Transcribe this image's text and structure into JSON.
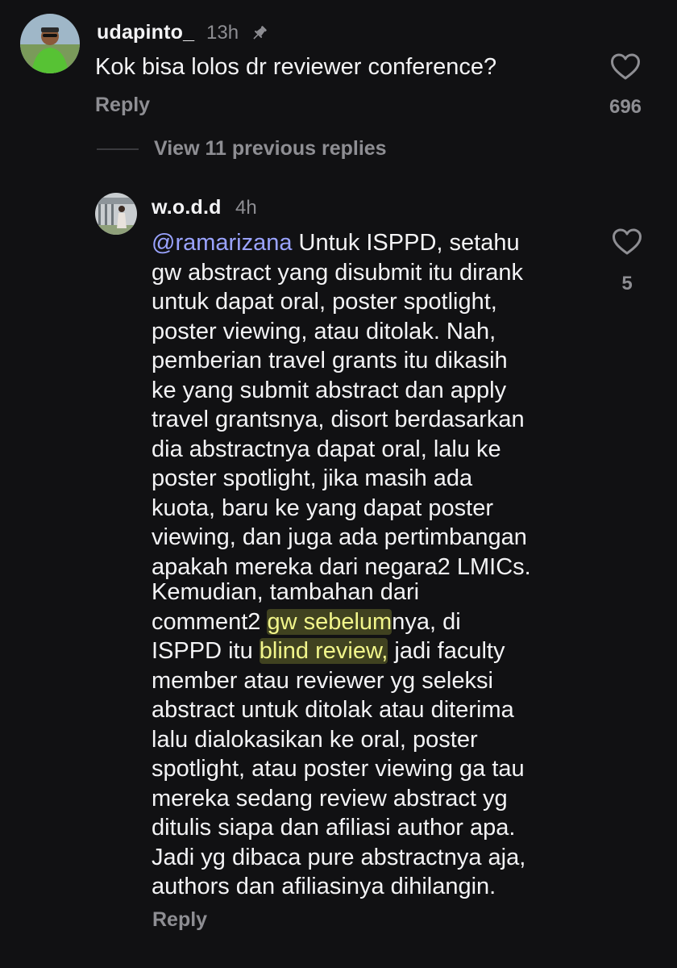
{
  "comment": {
    "username": "udapinto_",
    "time": "13h",
    "text": "Kok bisa lolos dr reviewer conference?",
    "reply_label": "Reply",
    "like_count": "696"
  },
  "view_replies_label": "View 11 previous replies",
  "reply": {
    "username": "w.o.d.d",
    "time": "4h",
    "mention": "@ramarizana",
    "para1_line1_rest": " Untuk ISPPD, setahu",
    "para1_lines": [
      "gw abstract yang disubmit itu dirank",
      "untuk dapat oral, poster spotlight,",
      "poster viewing, atau ditolak. Nah,",
      "pemberian travel grants itu dikasih",
      "ke yang submit abstract dan apply",
      "travel grantsnya, disort berdasarkan",
      "dia abstractnya dapat oral, lalu ke",
      "poster spotlight, jika masih ada",
      "kuota, baru ke yang dapat poster",
      "viewing, dan juga ada pertimbangan",
      "apakah mereka dari negara2 LMICs."
    ],
    "para2_line1": "Kemudian, tambahan dari",
    "para2_line2_a": "comment2 ",
    "para2_line2_hl": "gw sebelum",
    "para2_line2_b": "nya, di",
    "para2_line3_a": "ISPPD itu ",
    "para2_line3_hl": "blind review,",
    "para2_line3_b": " jadi faculty",
    "para2_lines": [
      "member atau reviewer yg seleksi",
      "abstract untuk ditolak atau diterima",
      "lalu dialokasikan ke oral, poster",
      "spotlight, atau poster viewing ga tau",
      "mereka sedang review abstract yg",
      "ditulis siapa dan afiliasi author apa.",
      "Jadi yg dibaca pure abstractnya aja,",
      "authors dan afiliasinya dihilangin."
    ],
    "reply_label": "Reply",
    "like_count": "5"
  },
  "colors": {
    "background": "#111113",
    "text": "#f3f3f5",
    "secondary": "#8e8e93",
    "mention": "#9aa3ff",
    "highlight": "#f1f58b"
  }
}
